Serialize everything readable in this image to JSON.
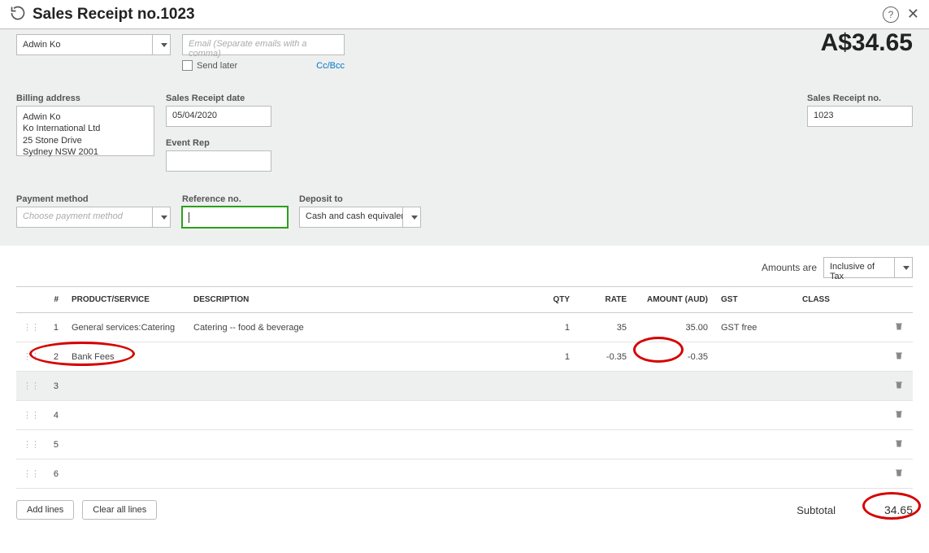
{
  "header": {
    "title": "Sales Receipt no.1023"
  },
  "customer": {
    "name": "Adwin Ko",
    "email_placeholder": "Email (Separate emails with a comma)",
    "send_later_label": "Send later",
    "ccbcc_label": "Cc/Bcc",
    "amount_display": "A$34.65"
  },
  "billing": {
    "label": "Billing address",
    "address": "Adwin Ko\nKo International Ltd\n25 Stone Drive\nSydney NSW  2001"
  },
  "receipt_date": {
    "label": "Sales Receipt date",
    "value": "05/04/2020"
  },
  "event_rep": {
    "label": "Event Rep",
    "value": ""
  },
  "receipt_no": {
    "label": "Sales Receipt no.",
    "value": "1023"
  },
  "payment_method": {
    "label": "Payment method",
    "placeholder": "Choose payment method"
  },
  "reference_no": {
    "label": "Reference no.",
    "value": ""
  },
  "deposit_to": {
    "label": "Deposit to",
    "value": "Cash and cash equivaler"
  },
  "amounts_are": {
    "label": "Amounts are",
    "value": "Inclusive of Tax"
  },
  "columns": {
    "num": "#",
    "product": "PRODUCT/SERVICE",
    "description": "DESCRIPTION",
    "qty": "QTY",
    "rate": "RATE",
    "amount": "AMOUNT (AUD)",
    "gst": "GST",
    "class": "CLASS"
  },
  "lines": [
    {
      "num": "1",
      "product": "General services:Catering",
      "description": "Catering -- food & beverage",
      "qty": "1",
      "rate": "35",
      "amount": "35.00",
      "gst": "GST free",
      "class": ""
    },
    {
      "num": "2",
      "product": "Bank Fees",
      "description": "",
      "qty": "1",
      "rate": "-0.35",
      "amount": "-0.35",
      "gst": "",
      "class": ""
    },
    {
      "num": "3",
      "product": "",
      "description": "",
      "qty": "",
      "rate": "",
      "amount": "",
      "gst": "",
      "class": ""
    },
    {
      "num": "4",
      "product": "",
      "description": "",
      "qty": "",
      "rate": "",
      "amount": "",
      "gst": "",
      "class": ""
    },
    {
      "num": "5",
      "product": "",
      "description": "",
      "qty": "",
      "rate": "",
      "amount": "",
      "gst": "",
      "class": ""
    },
    {
      "num": "6",
      "product": "",
      "description": "",
      "qty": "",
      "rate": "",
      "amount": "",
      "gst": "",
      "class": ""
    }
  ],
  "buttons": {
    "add_lines": "Add lines",
    "clear_all": "Clear all lines"
  },
  "subtotal": {
    "label": "Subtotal",
    "value": "34.65"
  }
}
